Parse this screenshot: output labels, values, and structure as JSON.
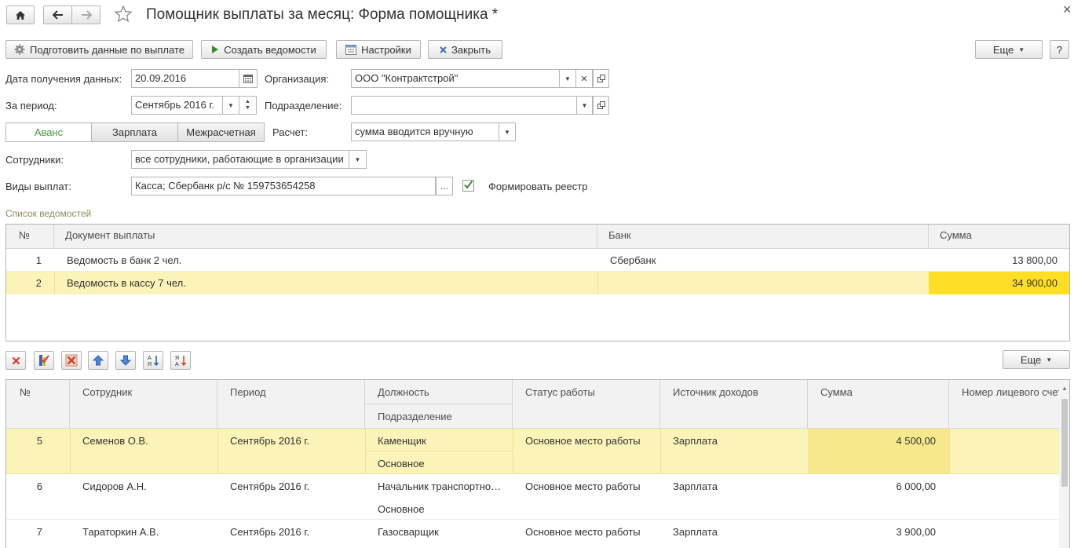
{
  "window": {
    "title": "Помощник выплаты за месяц: Форма помощника *",
    "close_symbol": "×"
  },
  "toolbar": {
    "prepare_label": "Подготовить данные по выплате",
    "create_label": "Создать ведомости",
    "settings_label": "Настройки",
    "close_label": "Закрыть",
    "more_label": "Еще",
    "help_label": "?"
  },
  "form": {
    "date_label": "Дата получения данных:",
    "date_value": "20.09.2016",
    "org_label": "Организация:",
    "org_value": "ООО \"Контрактстрой\"",
    "period_label": "За период:",
    "period_value": "Сентябрь 2016 г.",
    "dept_label": "Подразделение:",
    "dept_value": "",
    "payment_tabs": [
      "Аванс",
      "Зарплата",
      "Межрасчетная"
    ],
    "active_tab": "Аванс",
    "calc_label": "Расчет:",
    "calc_value": "сумма вводится вручную",
    "employees_label": "Сотрудники:",
    "employees_value": "все сотрудники, работающие в организации",
    "pay_types_label": "Виды выплат:",
    "pay_types_value": "Касса; Сбербанк р/с № 159753654258",
    "pay_types_button": "...",
    "registry_label": "Формировать реестр",
    "registry_checked": true
  },
  "statements": {
    "section_label": "Список ведомостей",
    "columns": [
      "№",
      "Документ выплаты",
      "Банк",
      "Сумма"
    ],
    "rows": [
      {
        "num": "1",
        "doc": "Ведомость в банк 2 чел.",
        "bank": "Сбербанк",
        "sum": "13 800,00"
      },
      {
        "num": "2",
        "doc": "Ведомость в кассу 7 чел.",
        "bank": "",
        "sum": "34 900,00"
      }
    ],
    "selected_row": 1
  },
  "employees_table": {
    "more_label": "Еще",
    "toolbar_icons": [
      "delete-icon",
      "pick-employees-icon",
      "clear-list-icon",
      "move-up-icon",
      "move-down-icon",
      "sort-asc-icon",
      "sort-desc-icon"
    ],
    "columns": [
      "№",
      "Сотрудник",
      "Период",
      "Должность",
      "Подразделение",
      "Статус работы",
      "Источник доходов",
      "Сумма",
      "Номер лицевого счета"
    ],
    "rows": [
      {
        "num": "5",
        "name": "Семенов О.В.",
        "period": "Сентябрь 2016 г.",
        "position": "Каменщик",
        "dept": "Основное",
        "status": "Основное место работы",
        "source": "Зарплата",
        "sum": "4 500,00",
        "account": ""
      },
      {
        "num": "6",
        "name": "Сидоров А.Н.",
        "period": "Сентябрь 2016 г.",
        "position": "Начальник транспортно…",
        "dept": "Основное",
        "status": "Основное место работы",
        "source": "Зарплата",
        "sum": "6 000,00",
        "account": ""
      },
      {
        "num": "7",
        "name": "Тараторкин А.В.",
        "period": "Сентябрь 2016 г.",
        "position": "Газосварщик",
        "dept": "",
        "status": "Основное место работы",
        "source": "Зарплата",
        "sum": "3 900,00",
        "account": ""
      }
    ],
    "selected_row": 0
  },
  "colors": {
    "accent_green": "#4a9a3a",
    "row_highlight": "#fbf3b7",
    "cell_highlight": "#ffdf26",
    "header_bg": "#f2f2f2"
  }
}
